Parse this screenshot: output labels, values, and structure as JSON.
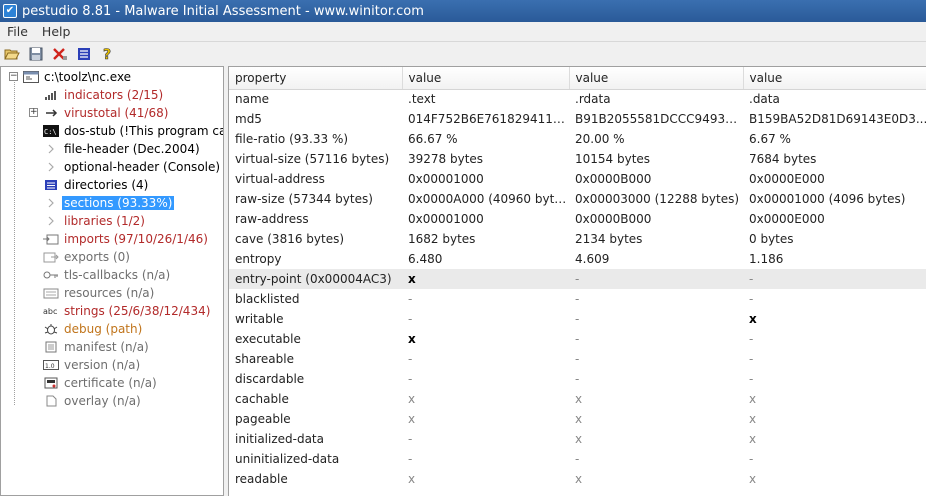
{
  "window": {
    "title": "pestudio 8.81 - Malware Initial Assessment - www.winitor.com"
  },
  "menu": [
    "File",
    "Help"
  ],
  "toolbar": {
    "icons": [
      "open-folder-icon",
      "save-icon",
      "delete-icon",
      "list-icon",
      "help-icon"
    ]
  },
  "tree": {
    "root": "c:\\toolz\\nc.exe",
    "items": [
      {
        "label": "indicators (2/15)",
        "color": "red",
        "icon": "indicators-icon"
      },
      {
        "label": "virustotal (41/68)",
        "color": "red",
        "icon": "virustotal-icon",
        "expandable": true
      },
      {
        "label": "dos-stub (!This program can",
        "color": "black",
        "icon": "dos-stub-icon"
      },
      {
        "label": "file-header (Dec.2004)",
        "color": "black",
        "icon": "file-header-icon"
      },
      {
        "label": "optional-header (Console)",
        "color": "black",
        "icon": "optional-header-icon"
      },
      {
        "label": "directories (4)",
        "color": "black",
        "icon": "directories-icon"
      },
      {
        "label": "sections (93.33%)",
        "color": "selected",
        "icon": "sections-icon"
      },
      {
        "label": "libraries (1/2)",
        "color": "red",
        "icon": "libraries-icon"
      },
      {
        "label": "imports (97/10/26/1/46)",
        "color": "red",
        "icon": "imports-icon"
      },
      {
        "label": "exports (0)",
        "color": "gray",
        "icon": "exports-icon"
      },
      {
        "label": "tls-callbacks (n/a)",
        "color": "gray",
        "icon": "tls-callbacks-icon"
      },
      {
        "label": "resources (n/a)",
        "color": "gray",
        "icon": "resources-icon"
      },
      {
        "label": "strings (25/6/38/12/434)",
        "color": "red",
        "icon": "strings-icon"
      },
      {
        "label": "debug (path)",
        "color": "orange",
        "icon": "debug-icon"
      },
      {
        "label": "manifest (n/a)",
        "color": "gray",
        "icon": "manifest-icon"
      },
      {
        "label": "version (n/a)",
        "color": "gray",
        "icon": "version-icon"
      },
      {
        "label": "certificate (n/a)",
        "color": "gray",
        "icon": "certificate-icon"
      },
      {
        "label": "overlay (n/a)",
        "color": "gray",
        "icon": "overlay-icon"
      }
    ]
  },
  "table": {
    "headers": [
      "property",
      "value",
      "value",
      "value"
    ],
    "rows": [
      {
        "cells": [
          "name",
          ".text",
          ".rdata",
          ".data"
        ]
      },
      {
        "cells": [
          "md5",
          "014F752B6E761829411F9...",
          "B91B2055581DCCC9493B9...",
          "B159BA52D81D69143E0D3..."
        ]
      },
      {
        "cells": [
          "file-ratio (93.33 %)",
          "66.67 %",
          "20.00 %",
          "6.67 %"
        ]
      },
      {
        "cells": [
          "virtual-size (57116 bytes)",
          "39278 bytes",
          "10154 bytes",
          "7684 bytes"
        ]
      },
      {
        "cells": [
          "virtual-address",
          "0x00001000",
          "0x0000B000",
          "0x0000E000"
        ]
      },
      {
        "cells": [
          "raw-size (57344 bytes)",
          "0x0000A000 (40960 bytes)",
          "0x00003000 (12288 bytes)",
          "0x00001000 (4096 bytes)"
        ]
      },
      {
        "cells": [
          "raw-address",
          "0x00001000",
          "0x0000B000",
          "0x0000E000"
        ]
      },
      {
        "cells": [
          "cave (3816 bytes)",
          "1682 bytes",
          "2134 bytes",
          "0 bytes"
        ]
      },
      {
        "cells": [
          "entropy",
          "6.480",
          "4.609",
          "1.186"
        ]
      },
      {
        "cells": [
          "entry-point (0x00004AC3)",
          "x",
          "-",
          "-"
        ],
        "style": [
          "",
          "bold",
          "dim",
          "dim"
        ],
        "highlight": true
      },
      {
        "cells": [
          "blacklisted",
          "-",
          "-",
          "-"
        ],
        "style": [
          "",
          "dim",
          "dim",
          "dim"
        ]
      },
      {
        "cells": [
          "writable",
          "-",
          "-",
          "x"
        ],
        "style": [
          "",
          "dim",
          "dim",
          "bold"
        ]
      },
      {
        "cells": [
          "executable",
          "x",
          "-",
          "-"
        ],
        "style": [
          "",
          "bold",
          "dim",
          "dim"
        ]
      },
      {
        "cells": [
          "shareable",
          "-",
          "-",
          "-"
        ],
        "style": [
          "",
          "dim",
          "dim",
          "dim"
        ]
      },
      {
        "cells": [
          "discardable",
          "-",
          "-",
          "-"
        ],
        "style": [
          "",
          "dim",
          "dim",
          "dim"
        ]
      },
      {
        "cells": [
          "cachable",
          "x",
          "x",
          "x"
        ],
        "style": [
          "",
          "dim",
          "dim",
          "dim"
        ]
      },
      {
        "cells": [
          "pageable",
          "x",
          "x",
          "x"
        ],
        "style": [
          "",
          "dim",
          "dim",
          "dim"
        ]
      },
      {
        "cells": [
          "initialized-data",
          "-",
          "x",
          "x"
        ],
        "style": [
          "",
          "dim",
          "dim",
          "dim"
        ]
      },
      {
        "cells": [
          "uninitialized-data",
          "-",
          "-",
          "-"
        ],
        "style": [
          "",
          "dim",
          "dim",
          "dim"
        ]
      },
      {
        "cells": [
          "readable",
          "x",
          "x",
          "x"
        ],
        "style": [
          "",
          "dim",
          "dim",
          "dim"
        ]
      }
    ]
  }
}
